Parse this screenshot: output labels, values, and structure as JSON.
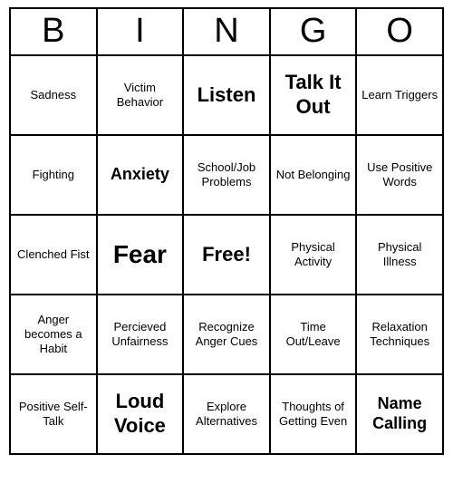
{
  "header": {
    "letters": [
      "B",
      "I",
      "N",
      "G",
      "O"
    ]
  },
  "grid": [
    [
      {
        "text": "Sadness",
        "size": "normal"
      },
      {
        "text": "Victim Behavior",
        "size": "normal"
      },
      {
        "text": "Listen",
        "size": "large"
      },
      {
        "text": "Talk It Out",
        "size": "large"
      },
      {
        "text": "Learn Triggers",
        "size": "normal"
      }
    ],
    [
      {
        "text": "Fighting",
        "size": "normal"
      },
      {
        "text": "Anxiety",
        "size": "medium"
      },
      {
        "text": "School/Job Problems",
        "size": "normal"
      },
      {
        "text": "Not Belonging",
        "size": "normal"
      },
      {
        "text": "Use Positive Words",
        "size": "normal"
      }
    ],
    [
      {
        "text": "Clenched Fist",
        "size": "normal"
      },
      {
        "text": "Fear",
        "size": "xlarge"
      },
      {
        "text": "Free!",
        "size": "free"
      },
      {
        "text": "Physical Activity",
        "size": "normal"
      },
      {
        "text": "Physical Illness",
        "size": "normal"
      }
    ],
    [
      {
        "text": "Anger becomes a Habit",
        "size": "normal"
      },
      {
        "text": "Percieved Unfairness",
        "size": "normal"
      },
      {
        "text": "Recognize Anger Cues",
        "size": "normal"
      },
      {
        "text": "Time Out/Leave",
        "size": "normal"
      },
      {
        "text": "Relaxation Techniques",
        "size": "normal"
      }
    ],
    [
      {
        "text": "Positive Self-Talk",
        "size": "normal"
      },
      {
        "text": "Loud Voice",
        "size": "large"
      },
      {
        "text": "Explore Alternatives",
        "size": "normal"
      },
      {
        "text": "Thoughts of Getting Even",
        "size": "normal"
      },
      {
        "text": "Name Calling",
        "size": "medium"
      }
    ]
  ]
}
